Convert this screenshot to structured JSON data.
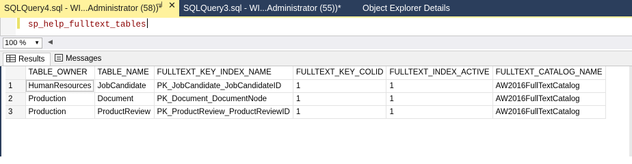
{
  "tabs": [
    {
      "label": "SQLQuery4.sql - WI...Administrator (58))*",
      "active": true
    },
    {
      "label": "SQLQuery3.sql - WI...Administrator (55))*",
      "active": false
    },
    {
      "label": "Object Explorer Details",
      "active": false
    }
  ],
  "tab_controls": {
    "pin": "⊣",
    "close": "✕"
  },
  "editor": {
    "code": "sp_help_fulltext_tables"
  },
  "zoom": {
    "value": "100 %"
  },
  "result_tabs": {
    "results": "Results",
    "messages": "Messages"
  },
  "grid": {
    "columns": [
      "TABLE_OWNER",
      "TABLE_NAME",
      "FULLTEXT_KEY_INDEX_NAME",
      "FULLTEXT_KEY_COLID",
      "FULLTEXT_INDEX_ACTIVE",
      "FULLTEXT_CATALOG_NAME"
    ],
    "rows": [
      {
        "n": "1",
        "cells": [
          "HumanResources",
          "JobCandidate",
          "PK_JobCandidate_JobCandidateID",
          "1",
          "1",
          "AW2016FullTextCatalog"
        ]
      },
      {
        "n": "2",
        "cells": [
          "Production",
          "Document",
          "PK_Document_DocumentNode",
          "1",
          "1",
          "AW2016FullTextCatalog"
        ]
      },
      {
        "n": "3",
        "cells": [
          "Production",
          "ProductReview",
          "PK_ProductReview_ProductReviewID",
          "1",
          "1",
          "AW2016FullTextCatalog"
        ]
      }
    ]
  },
  "colors": {
    "tab_active": "#fff29d",
    "tabstrip": "#2b3e5c",
    "code": "#8b0000"
  },
  "icons": [
    "pin-icon",
    "close-icon",
    "results-grid-icon",
    "messages-icon",
    "dropdown-arrow-icon"
  ]
}
